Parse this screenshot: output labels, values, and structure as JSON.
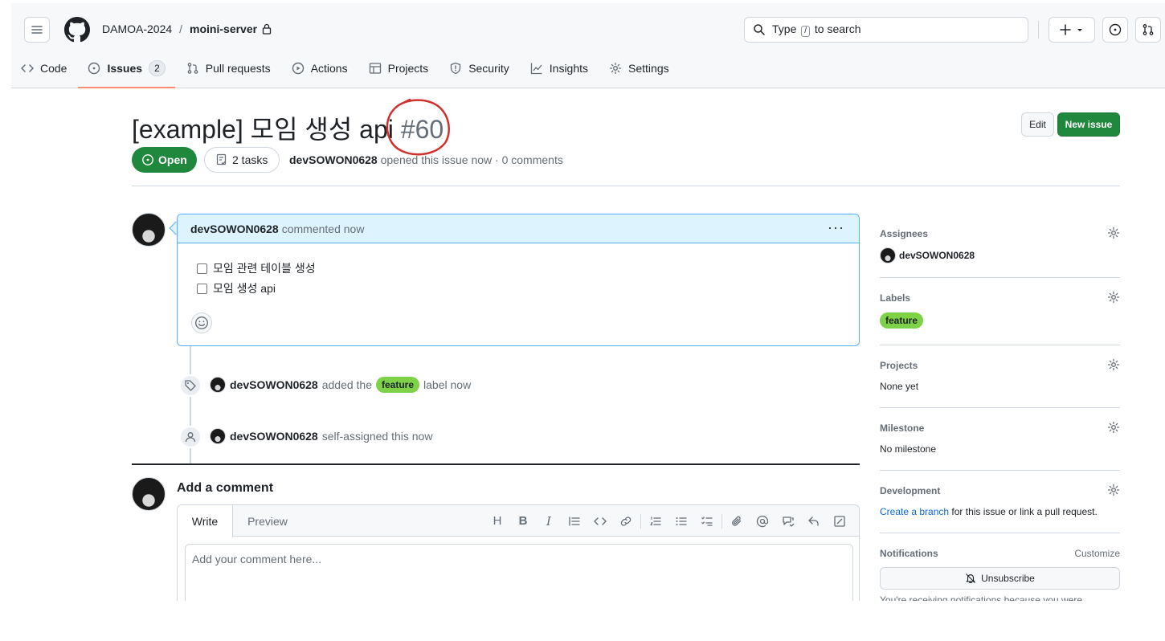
{
  "header": {
    "owner": "DAMOA-2024",
    "separator": "/",
    "repo": "moini-server",
    "search_prefix": "Type",
    "search_key": "/",
    "search_suffix": "to search"
  },
  "tabs": [
    {
      "label": "Code"
    },
    {
      "label": "Issues",
      "count": "2"
    },
    {
      "label": "Pull requests"
    },
    {
      "label": "Actions"
    },
    {
      "label": "Projects"
    },
    {
      "label": "Security"
    },
    {
      "label": "Insights"
    },
    {
      "label": "Settings"
    }
  ],
  "issue": {
    "title": "[example] 모임 생성 api",
    "number": "#60",
    "state": "Open",
    "tasks": "2 tasks",
    "author": "devSOWON0628",
    "meta_rest": "opened this issue now · 0 comments",
    "edit_label": "Edit",
    "new_label": "New issue"
  },
  "comment": {
    "author": "devSOWON0628",
    "action": "commented now",
    "tasks": [
      "모임 관련 테이블 생성",
      "모임 생성 api"
    ]
  },
  "events": [
    {
      "author": "devSOWON0628",
      "pre": "added the",
      "label": "feature",
      "post": "label now"
    },
    {
      "author": "devSOWON0628",
      "pre": "self-assigned this now"
    }
  ],
  "add_comment": {
    "title": "Add a comment",
    "write_tab": "Write",
    "preview_tab": "Preview",
    "placeholder": "Add your comment here..."
  },
  "sidebar": {
    "assignees": {
      "title": "Assignees",
      "value": "devSOWON0628"
    },
    "labels": {
      "title": "Labels",
      "value": "feature"
    },
    "projects": {
      "title": "Projects",
      "value": "None yet"
    },
    "milestone": {
      "title": "Milestone",
      "value": "No milestone"
    },
    "development": {
      "title": "Development",
      "link": "Create a branch",
      "rest": "for this issue or link a pull request."
    },
    "notifications": {
      "title": "Notifications",
      "customize": "Customize",
      "button": "Unsubscribe",
      "note": "You're receiving notifications because you were"
    }
  },
  "colors": {
    "accent_green": "#1f883d",
    "label_feature": "#7ed248",
    "annotation_red": "#d0312d",
    "link_blue": "#0969da"
  }
}
